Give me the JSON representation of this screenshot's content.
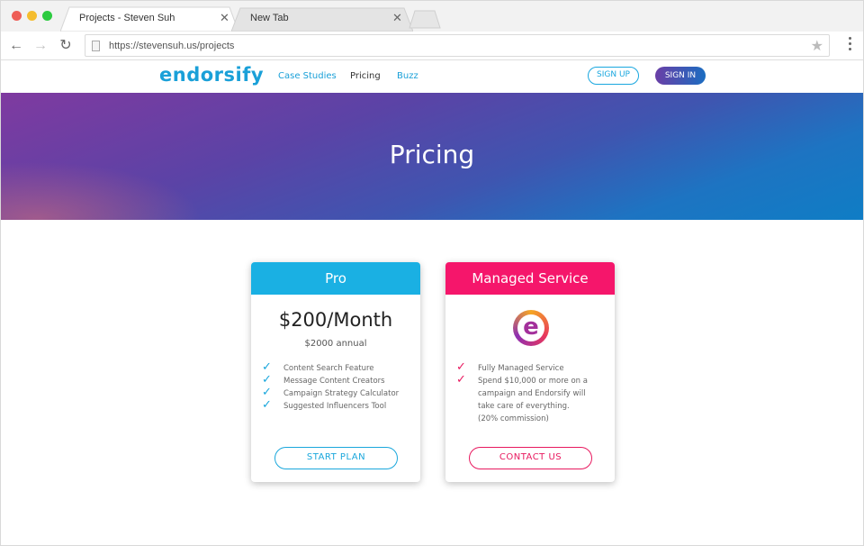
{
  "browser": {
    "tabs": [
      {
        "label": "Projects - Steven Suh",
        "active": true
      },
      {
        "label": "New Tab",
        "active": false
      }
    ],
    "url": "https://stevensuh.us/projects"
  },
  "site": {
    "logo": "endorsify",
    "nav": [
      {
        "label": "Case Studies",
        "color": "#1aa0d8"
      },
      {
        "label": "Pricing",
        "color": "#333333"
      },
      {
        "label": "Buzz",
        "color": "#1aa0d8"
      }
    ],
    "signup_label": "SIGN UP",
    "signin_label": "SIGN IN"
  },
  "hero": {
    "title": "Pricing"
  },
  "plans": [
    {
      "name": "Pro",
      "header_color": "#1ab0e3",
      "price": "$200/Month",
      "price_sub": "$2000 annual",
      "features": [
        "Content Search Feature",
        "Message Content Creators",
        "Campaign Strategy Calculator",
        "Suggested Influencers Tool"
      ],
      "button_label": "START PLAN",
      "accent": "#1aa7dc"
    },
    {
      "name": "Managed Service",
      "header_color": "#f5166b",
      "icon": "endorsify-e-logo",
      "features": [
        "Fully Managed Service",
        "Spend $10,000 or more on a"
      ],
      "feature_continuation": [
        "campaign and Endorsify will",
        "take care of everything.",
        "(20% commission)"
      ],
      "button_label": "CONTACT US",
      "accent": "#e8195f"
    }
  ]
}
